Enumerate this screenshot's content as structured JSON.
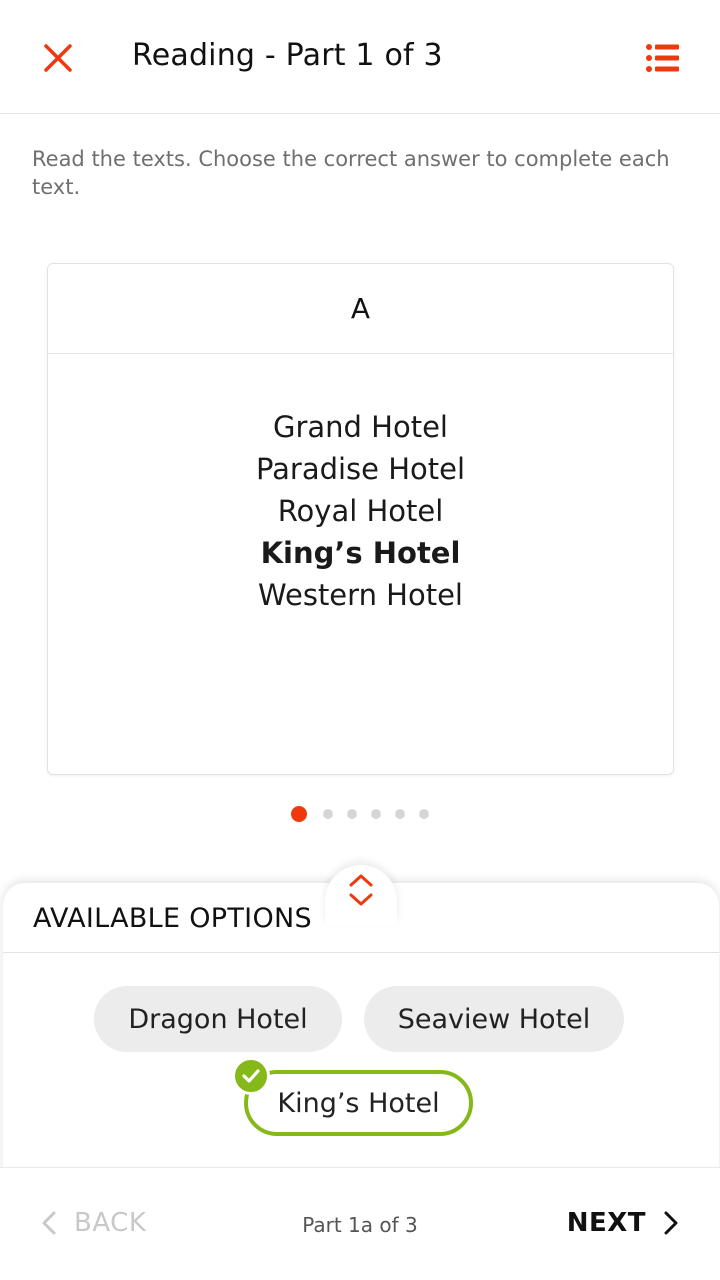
{
  "header": {
    "title": "Reading - Part 1 of 3",
    "close_icon": "close-icon",
    "list_icon": "list-icon",
    "accent_color": "#f0380f"
  },
  "instruction": "Read the texts. Choose the correct answer to complete each text.",
  "card": {
    "label": "A",
    "lines": [
      {
        "text": "Grand Hotel",
        "bold": false
      },
      {
        "text": "Paradise Hotel",
        "bold": false
      },
      {
        "text": "Royal Hotel",
        "bold": false
      },
      {
        "text": "King’s Hotel",
        "bold": true
      },
      {
        "text": "Western Hotel",
        "bold": false
      }
    ]
  },
  "pagination": {
    "total": 6,
    "active_index": 0,
    "active_color": "#f0380f"
  },
  "options_panel": {
    "title": "AVAILABLE OPTIONS",
    "toggle_icon": "expand-collapse-icon",
    "options": [
      {
        "label": "Dragon Hotel",
        "selected": false
      },
      {
        "label": "Seaview Hotel",
        "selected": false
      },
      {
        "label": "King’s Hotel",
        "selected": true
      }
    ],
    "selected_color": "#86b81a"
  },
  "footer": {
    "back_label": "BACK",
    "progress": "Part 1a of 3",
    "next_label": "NEXT"
  }
}
